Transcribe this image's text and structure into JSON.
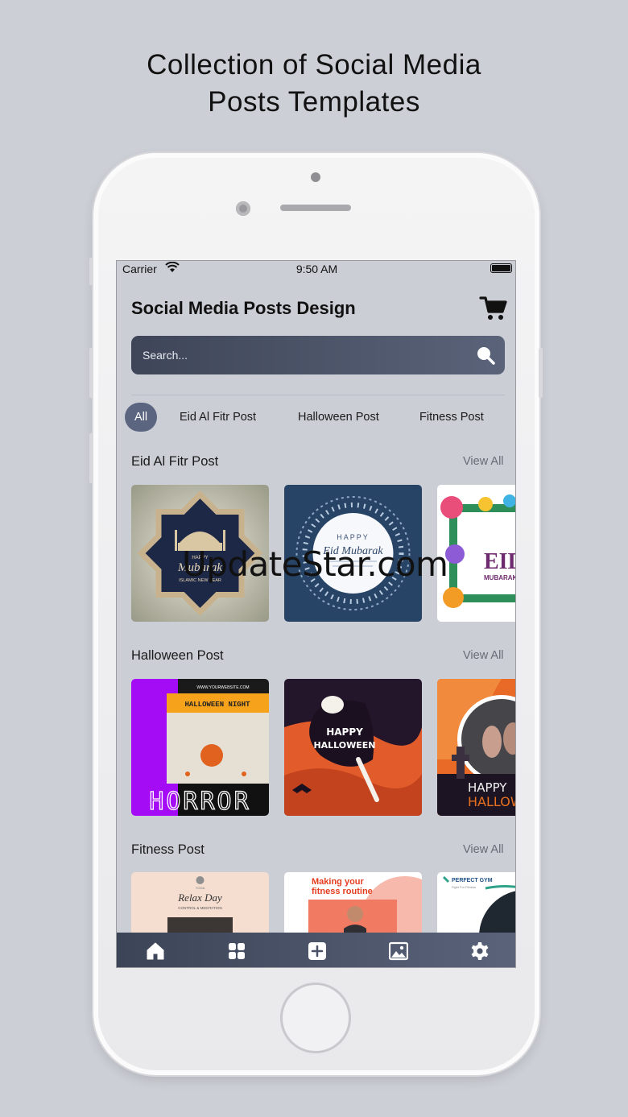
{
  "headline": [
    "Collection of Social Media",
    "Posts Templates"
  ],
  "status_bar": {
    "carrier": "Carrier",
    "time": "9:50 AM"
  },
  "app": {
    "title": "Social Media Posts Design"
  },
  "search": {
    "placeholder": "Search..."
  },
  "categories": [
    "All",
    "Eid Al Fitr Post",
    "Halloween Post",
    "Fitness Post"
  ],
  "selected_category": "All",
  "sections": [
    {
      "title": "Eid Al Fitr Post",
      "view_all": "View All",
      "cards": [
        {
          "line1": "HAPPY",
          "line2": "Mubarak",
          "line3": "ISLAMIC NEW YEAR"
        },
        {
          "line1": "HAPPY",
          "line2": "Eid Mubarak"
        },
        {
          "line1": "EID",
          "line2": "MUBARAK"
        }
      ]
    },
    {
      "title": "Halloween Post",
      "view_all": "View All",
      "cards": [
        {
          "line0": "WWW.YOURWEBSITE.COM",
          "line1": "HALLOWEEN NIGHT",
          "line2": "HORROR"
        },
        {
          "line1": "HAPPY",
          "line2": "HALLOWEEN"
        },
        {
          "line1": "HAPPY",
          "line2": "HALLOW"
        }
      ]
    },
    {
      "title": "Fitness Post",
      "view_all": "View All",
      "cards": [
        {
          "line0": "YOGA",
          "line1": "Relax Day",
          "line2": "CONTROL & MEDITATION"
        },
        {
          "line1": "Making your",
          "line2": "fitness routine"
        },
        {
          "line1": "PERFECT GYM",
          "line2": "Fight For Fitness"
        }
      ]
    }
  ],
  "watermark": "UpdateStar.com",
  "nav": [
    "home-icon",
    "grid-icon",
    "add-icon",
    "image-icon",
    "settings-icon"
  ],
  "colors": {
    "accent": "#5b6580",
    "navbar": "#4a5268",
    "background": "#ccced6"
  }
}
